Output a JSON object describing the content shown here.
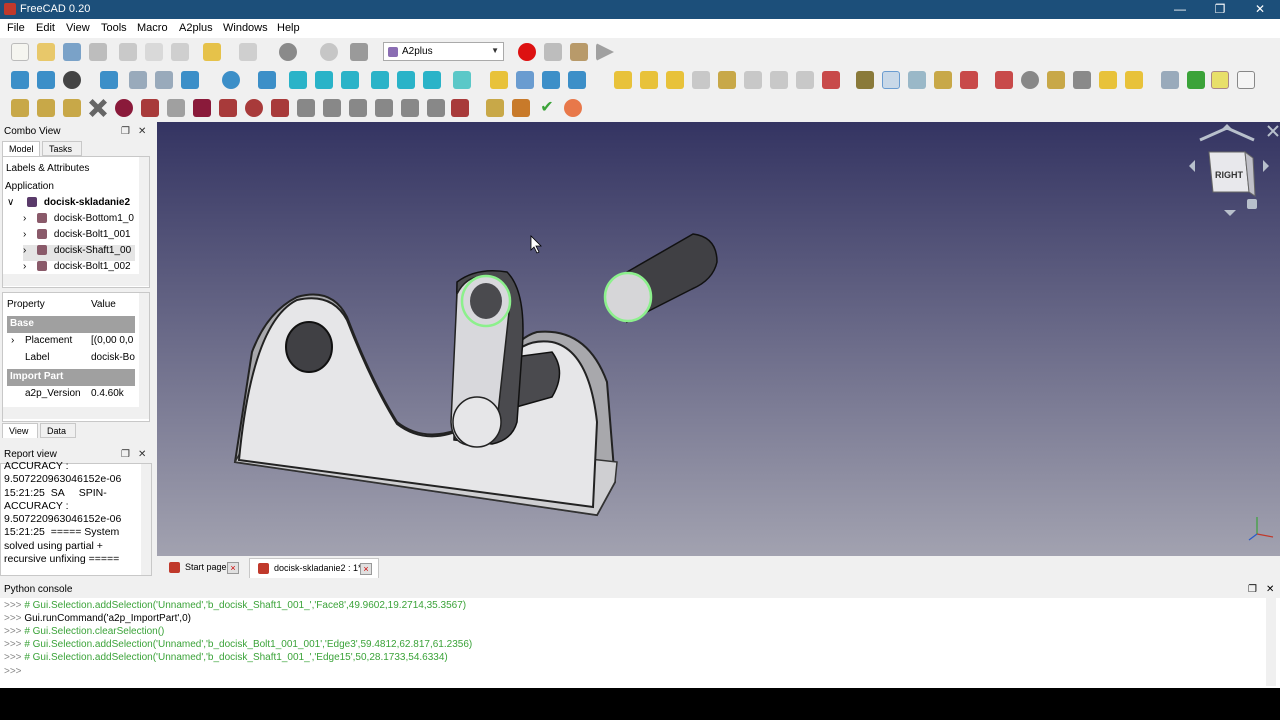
{
  "window": {
    "title": "FreeCAD 0.20"
  },
  "menu": [
    "File",
    "Edit",
    "View",
    "Tools",
    "Macro",
    "A2plus",
    "Windows",
    "Help"
  ],
  "workbench_selector": {
    "value": "A2plus"
  },
  "combo_view": {
    "title": "Combo View",
    "tabs": [
      "Model",
      "Tasks"
    ],
    "tree_header": "Labels & Attributes",
    "tree_section": "Application",
    "document": "docisk-skladanie2",
    "items": [
      "docisk-Bottom1_0",
      "docisk-Bolt1_001",
      "docisk-Shaft1_00",
      "docisk-Bolt1_002"
    ],
    "property_header": {
      "property": "Property",
      "value": "Value"
    },
    "groups": [
      {
        "name": "Base",
        "rows": [
          {
            "name": "Placement",
            "value": "[(0,00 0,0"
          },
          {
            "name": "Label",
            "value": "docisk-Bo"
          }
        ]
      },
      {
        "name": "Import Part",
        "rows": [
          {
            "name": "a2p_Version",
            "value": "0.4.60k"
          }
        ]
      }
    ],
    "bottom_tabs": [
      "View",
      "Data"
    ]
  },
  "report_view": {
    "title": "Report view",
    "text": "ACCURACY :\n9.507220963046152e-06\n15:21:25  SA     SPIN-\nACCURACY :\n9.507220963046152e-06\n15:21:25  ===== System\nsolved using partial +\nrecursive unfixing ====="
  },
  "navcube": {
    "face_label": "RIGHT"
  },
  "doc_tabs": [
    {
      "label": "Start page",
      "active": false
    },
    {
      "label": "docisk-skladanie2 : 1*",
      "active": true
    }
  ],
  "python_console": {
    "title": "Python console",
    "lines": [
      {
        "prompt": ">>>",
        "text": "# Gui.Selection.addSelection('Unnamed','b_docisk_Shaft1_001_','Face8',49.9602,19.2714,35.3567)",
        "kind": "comment"
      },
      {
        "prompt": ">>>",
        "text": "Gui.runCommand('a2p_ImportPart',0)",
        "kind": "code"
      },
      {
        "prompt": ">>>",
        "text": "# Gui.Selection.clearSelection()",
        "kind": "comment"
      },
      {
        "prompt": ">>>",
        "text": "# Gui.Selection.addSelection('Unnamed','b_docisk_Bolt1_001_001','Edge3',59.4812,62.817,61.2356)",
        "kind": "comment"
      },
      {
        "prompt": ">>>",
        "text": "# Gui.Selection.addSelection('Unnamed','b_docisk_Shaft1_001_','Edge15',50,28.1733,54.6334)",
        "kind": "comment"
      },
      {
        "prompt": ">>>",
        "text": "",
        "kind": "code"
      }
    ]
  },
  "colors": {
    "titlebar": "#1c4f7a",
    "viewport_top": "#343462",
    "viewport_bottom": "#a2a2b0",
    "selection": "#8cf08c"
  }
}
